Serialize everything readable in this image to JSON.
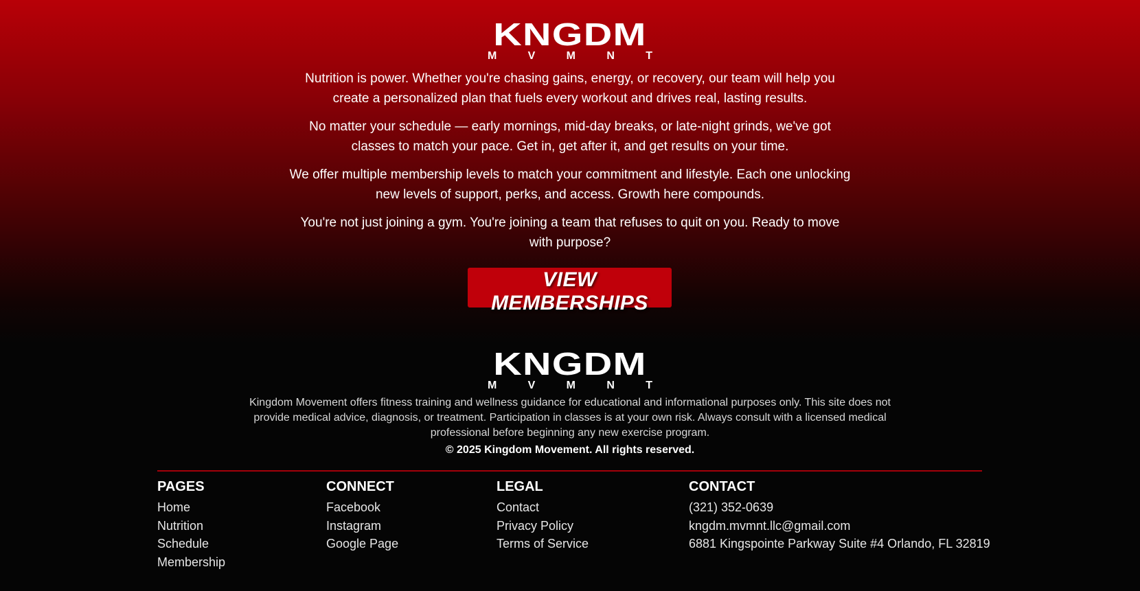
{
  "brand": {
    "logo_word": "KNGDM",
    "logo_sub": [
      "M",
      "V",
      "M",
      "N",
      "T"
    ]
  },
  "intro": {
    "paragraphs": [
      "Nutrition is power. Whether you're chasing gains, energy, or recovery, our team will help you create a personalized plan that fuels every workout and drives real, lasting results.",
      "No matter your schedule — early mornings, mid-day breaks, or late-night grinds, we've got classes to match your pace. Get in, get after it, and get results on your time.",
      "We offer multiple membership levels to match your commitment and lifestyle. Each one unlocking new levels of support, perks, and access. Growth here compounds.",
      "You're not just joining a gym. You're joining a team that refuses to quit on you. Ready to move with purpose?"
    ],
    "cta_label": "VIEW MEMBERSHIPS"
  },
  "footer": {
    "disclaimer": "Kingdom Movement offers fitness training and wellness guidance for educational and informational purposes only. This site does not provide medical advice, diagnosis, or treatment. Participation in classes is at your own risk. Always consult with a licensed medical professional before beginning any new exercise program.",
    "copyright": "© 2025 Kingdom Movement. All rights reserved.",
    "columns": {
      "pages": {
        "title": "PAGES",
        "items": [
          "Home",
          "Nutrition",
          "Schedule",
          "Membership"
        ]
      },
      "connect": {
        "title": "CONNECT",
        "items": [
          "Facebook",
          "Instagram",
          "Google Page"
        ]
      },
      "legal": {
        "title": "LEGAL",
        "items": [
          "Contact",
          "Privacy Policy",
          "Terms of Service"
        ]
      },
      "contact": {
        "title": "CONTACT",
        "items": [
          "(321) 352-0639",
          "kngdm.mvmnt.llc@gmail.com",
          "6881 Kingspointe Parkway Suite #4 Orlando, FL 32819"
        ]
      }
    }
  },
  "colors": {
    "brand_red": "#c0000a",
    "divider_red": "#a4000a",
    "background": "#050505"
  }
}
